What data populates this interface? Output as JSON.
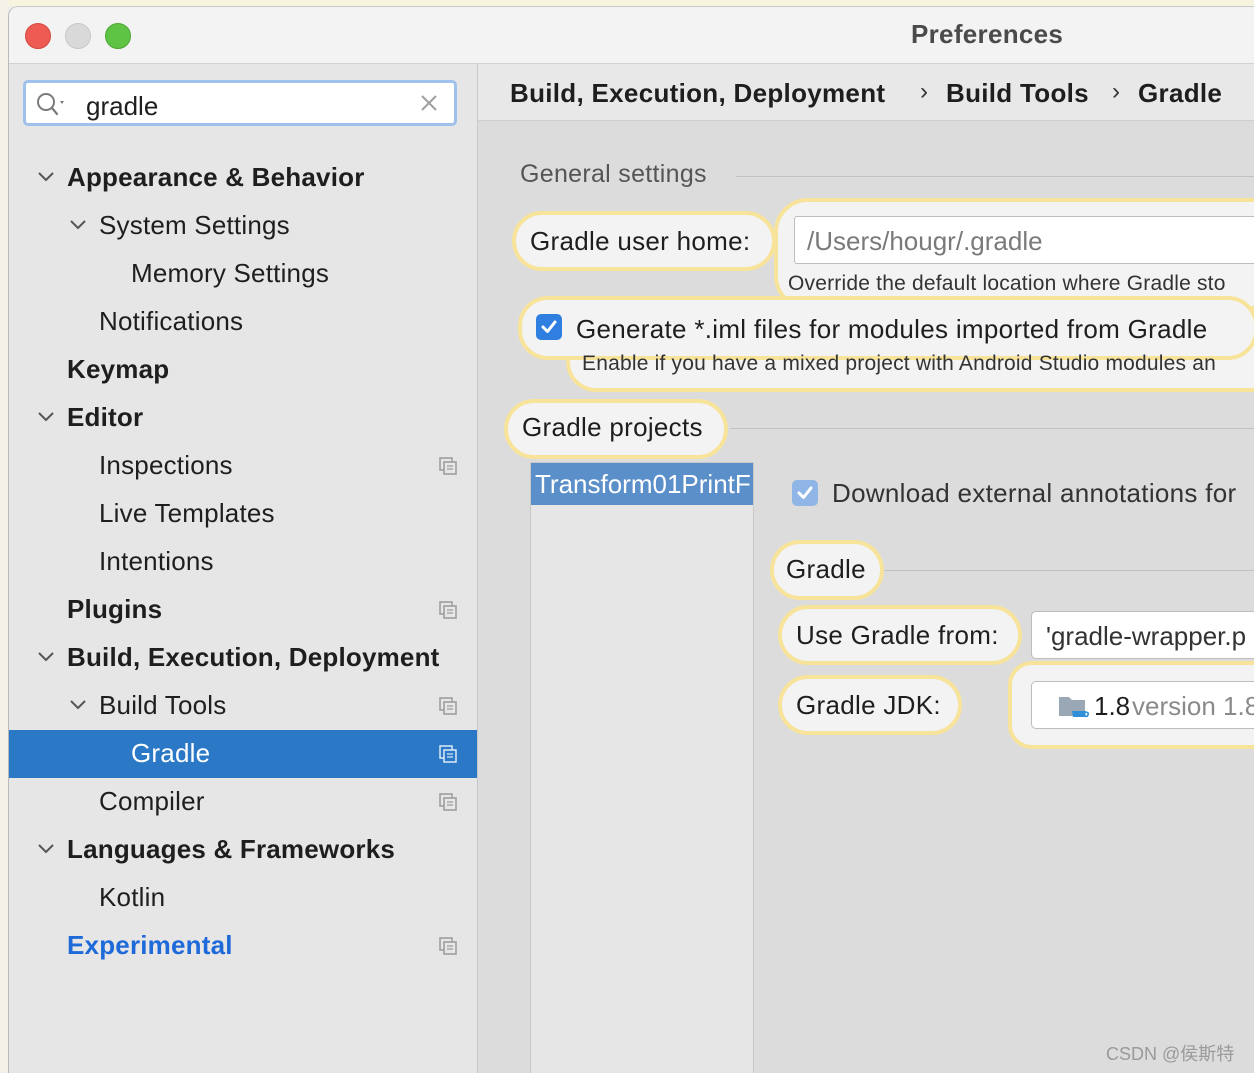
{
  "window": {
    "title": "Preferences"
  },
  "search": {
    "value": "gradle"
  },
  "sidebar": {
    "items": [
      {
        "label": "Appearance & Behavior",
        "level": 0,
        "expanded": true,
        "bold": true
      },
      {
        "label": "System Settings",
        "level": 1,
        "expanded": true
      },
      {
        "label": "Memory Settings",
        "level": 2
      },
      {
        "label": "Notifications",
        "level": 1
      },
      {
        "label": "Keymap",
        "level": 0,
        "bold": true
      },
      {
        "label": "Editor",
        "level": 0,
        "expanded": true,
        "bold": true
      },
      {
        "label": "Inspections",
        "level": 1,
        "project_icon": true
      },
      {
        "label": "Live Templates",
        "level": 1
      },
      {
        "label": "Intentions",
        "level": 1
      },
      {
        "label": "Plugins",
        "level": 0,
        "bold": true,
        "project_icon": true
      },
      {
        "label": "Build, Execution, Deployment",
        "level": 0,
        "expanded": true,
        "bold": true
      },
      {
        "label": "Build Tools",
        "level": 1,
        "expanded": true,
        "project_icon": true
      },
      {
        "label": "Gradle",
        "level": 2,
        "selected": true,
        "project_icon": true
      },
      {
        "label": "Compiler",
        "level": 1,
        "project_icon": true
      },
      {
        "label": "Languages & Frameworks",
        "level": 0,
        "expanded": true,
        "bold": true
      },
      {
        "label": "Kotlin",
        "level": 1
      },
      {
        "label": "Experimental",
        "level": 0,
        "link": true,
        "project_icon": true
      }
    ]
  },
  "breadcrumb": {
    "items": [
      "Build, Execution, Deployment",
      "Build Tools",
      "Gradle"
    ],
    "separator": "›"
  },
  "general": {
    "section_title": "General settings",
    "user_home_label": "Gradle user home:",
    "user_home_value": "/Users/hougr/.gradle",
    "user_home_hint": "Override the default location where Gradle sto",
    "generate_iml_label": "Generate *.iml files for modules imported from Gradle",
    "generate_iml_hint": "Enable if you have a mixed project with Android Studio modules an",
    "generate_iml_checked": true
  },
  "projects": {
    "section_title": "Gradle projects",
    "list": [
      "Transform01PrintF"
    ],
    "download_annotations_label": "Download external annotations for",
    "download_annotations_checked": true,
    "gradle_section_title": "Gradle",
    "use_gradle_from_label": "Use Gradle from:",
    "use_gradle_from_value": "'gradle-wrapper.p",
    "gradle_jdk_label": "Gradle JDK:",
    "gradle_jdk_version": "1.8",
    "gradle_jdk_detail": " version 1.8"
  },
  "watermark": "CSDN @侯斯特",
  "colors": {
    "selection": "#2a78c6",
    "highlight_border": "#f7e39a",
    "link": "#1e6ad9",
    "checkbox": "#2f7fe0"
  }
}
